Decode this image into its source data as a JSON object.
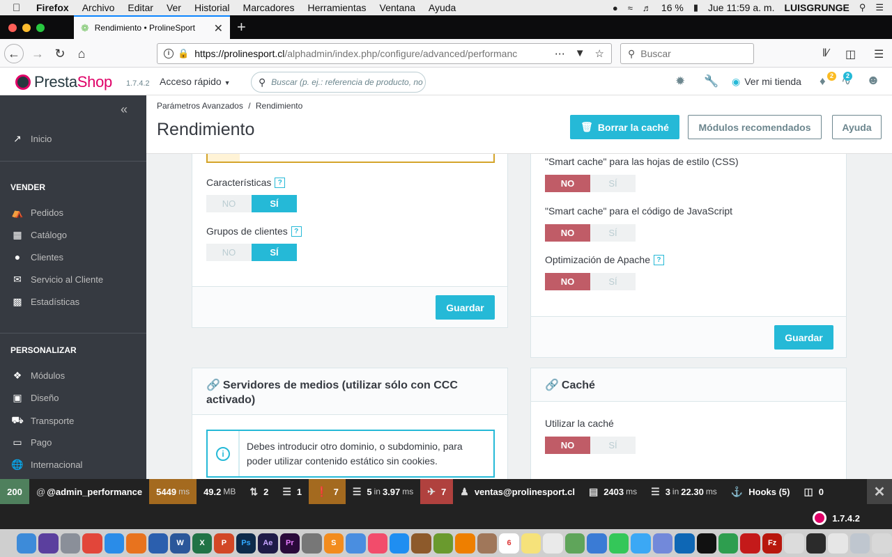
{
  "menubar": {
    "app": "Firefox",
    "items": [
      "Archivo",
      "Editar",
      "Ver",
      "Historial",
      "Marcadores",
      "Herramientas",
      "Ventana",
      "Ayuda"
    ],
    "battery": "16 %",
    "clock": "Jue 11:59 a. m.",
    "user": "LUISGRUNGE"
  },
  "browser": {
    "tab_title": "Rendimiento • ProlineSport",
    "url_host": "https://prolinesport.cl",
    "url_path": "/alphadmin/index.php/configure/advanced/performanc",
    "search_placeholder": "Buscar"
  },
  "ps_header": {
    "logo_a": "Presta",
    "logo_b": "Shop",
    "version": "1.7.4.2",
    "quick_access": "Acceso rápido",
    "search_placeholder": "Buscar (p. ej.: referencia de producto, no",
    "view_shop": "Ver mi tienda",
    "orders_badge": "2",
    "customers_badge": "2"
  },
  "sidebar": {
    "home": "Inicio",
    "section_sell": "VENDER",
    "sell_items": [
      "Pedidos",
      "Catálogo",
      "Clientes",
      "Servicio al Cliente",
      "Estadísticas"
    ],
    "section_customize": "PERSONALIZAR",
    "customize_items": [
      "Módulos",
      "Diseño",
      "Transporte",
      "Pago",
      "Internacional"
    ]
  },
  "page": {
    "breadcrumb_parent": "Parámetros Avanzados",
    "breadcrumb_sep": "/",
    "breadcrumb_current": "Rendimiento",
    "title": "Rendimiento",
    "btn_clear_cache": "Borrar la caché",
    "btn_recommended": "Módulos recomendados",
    "btn_help": "Ayuda"
  },
  "left_panel": {
    "field_features": "Características",
    "field_groups": "Grupos de clientes",
    "no": "NO",
    "si": "SÍ",
    "save": "Guardar"
  },
  "right_panel": {
    "field_css": "\"Smart cache\" para las hojas de estilo (CSS)",
    "field_js": "\"Smart cache\" para el código de JavaScript",
    "field_apache": "Optimización de Apache",
    "no": "NO",
    "si": "SÍ",
    "save": "Guardar"
  },
  "media_panel": {
    "title": "Servidores de medios (utilizar sólo con CCC activado)",
    "alert": "Debes introducir otro dominio, o subdominio, para poder utilizar contenido estático sin cookies."
  },
  "cache_panel": {
    "title": "Caché",
    "field_use_cache": "Utilizar la caché",
    "no": "NO",
    "si": "SÍ"
  },
  "profiler": {
    "status": "200",
    "route": "@admin_performance",
    "time_value": "5449",
    "time_unit": "ms",
    "memory_value": "49.2",
    "memory_unit": "MB",
    "forms": "2",
    "logs": "1",
    "warnings": "7",
    "db_queries": "5",
    "db_in": "in",
    "db_time": "3.97",
    "db_unit": "ms",
    "translations": "7",
    "user": "ventas@prolinesport.cl",
    "twig_time": "2403",
    "twig_unit": "ms",
    "cache_calls": "3",
    "cache_in": "in",
    "cache_time": "22.30",
    "cache_unit": "ms",
    "hooks": "Hooks (5)",
    "modules": "0",
    "version": "1.7.4.2"
  }
}
